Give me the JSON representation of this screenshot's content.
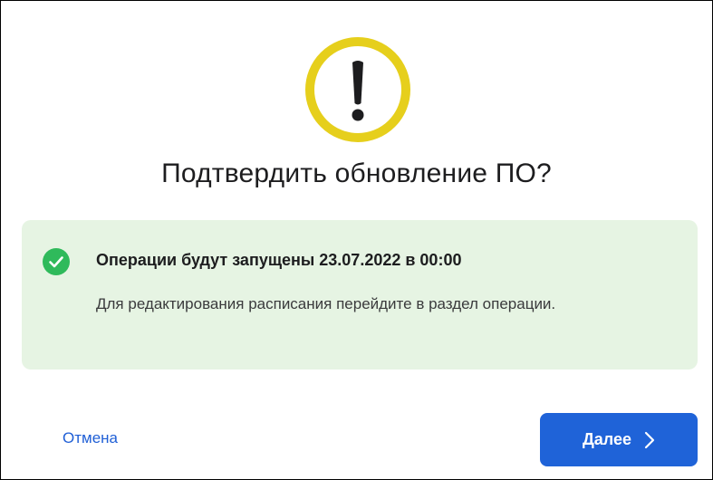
{
  "dialog": {
    "title": "Подтвердить обновление ПО?",
    "warning_icon": "exclamation-circle-icon",
    "warning_color": "#e6cf1c"
  },
  "notice": {
    "icon": "check-circle-icon",
    "icon_color": "#2fba5b",
    "background": "#e6f4e3",
    "heading": "Операции будут запущены 23.07.2022 в 00:00",
    "body": "Для редактирования расписания перейдите в раздел операции."
  },
  "actions": {
    "cancel_label": "Отмена",
    "next_label": "Далее",
    "next_icon": "chevron-right-icon",
    "accent_color": "#1f63d8"
  }
}
